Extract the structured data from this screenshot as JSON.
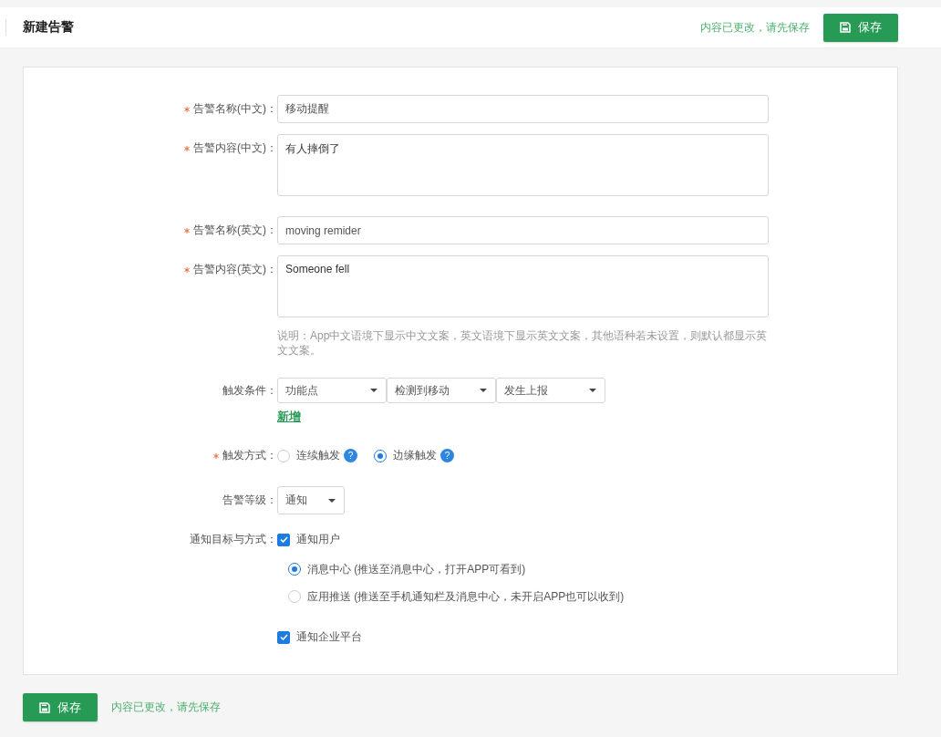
{
  "header": {
    "title": "新建告警",
    "notice": "内容已更改，请先保存",
    "save_button": "保存"
  },
  "form": {
    "fields": [
      {
        "kind": "input",
        "label": "告警名称(中文)：",
        "required": true,
        "value": "移动提醒"
      },
      {
        "kind": "textarea",
        "label": "告警内容(中文)：",
        "required": true,
        "value": "有人摔倒了"
      },
      {
        "kind": "input",
        "label": "告警名称(英文)：",
        "required": true,
        "value": "moving remider"
      },
      {
        "kind": "textarea",
        "label": "告警内容(英文)：",
        "required": true,
        "value": "Someone fell"
      }
    ],
    "note": "说明：App中文语境下显示中文文案，英文语境下显示英文文案，其他语种若未设置，则默认都显示英文文案。",
    "trigger": {
      "label": "触发条件：",
      "required": false,
      "selects": [
        "功能点",
        "检测到移动",
        "发生上报"
      ],
      "add_link": "新增"
    },
    "trigger_mode": {
      "label": "触发方式：",
      "required": true,
      "options": [
        {
          "label": "连续触发",
          "help": "?",
          "selected": false
        },
        {
          "label": "边缘触发",
          "help": "?",
          "selected": true
        }
      ]
    },
    "level": {
      "label": "告警等级：",
      "required": false,
      "value": "通知"
    },
    "notify": {
      "label": "通知目标与方式：",
      "required": false,
      "options": [
        {
          "label": "通知用户",
          "checked": true,
          "children": [
            {
              "label": "消息中心 (推送至消息中心，打开APP可看到)",
              "selected": true
            },
            {
              "label": "应用推送 (推送至手机通知栏及消息中心，未开启APP也可以收到)",
              "selected": false
            }
          ]
        },
        {
          "label": "通知企业平台",
          "checked": true
        }
      ]
    }
  },
  "footer": {
    "save_button": "保存",
    "notice": "内容已更改，请先保存"
  }
}
